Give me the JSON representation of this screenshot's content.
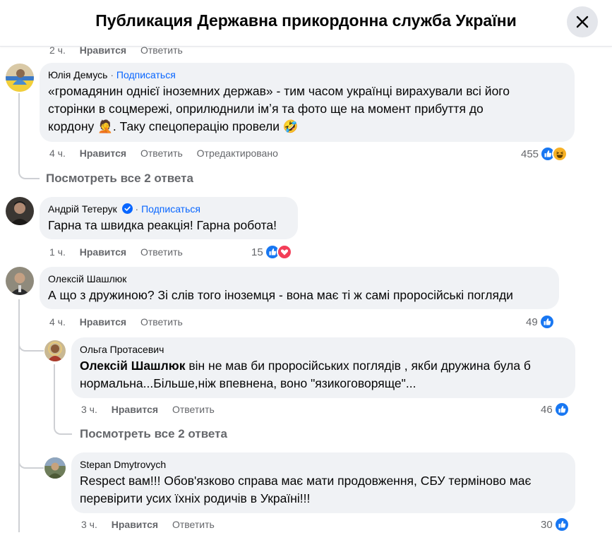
{
  "header": {
    "title": "Публикация Державна прикордонна служба України",
    "close_icon": "close-icon"
  },
  "top_partial": {
    "time": "2 ч.",
    "like": "Нравится",
    "reply": "Ответить"
  },
  "comments": [
    {
      "author": "Юлія Демусь",
      "separator": "·",
      "subscribe": "Подписаться",
      "lines": [
        "«громадянин однієї іноземних держав» - тим часом українці вирахували всі його",
        "сторінки в соцмережі, оприлюднили імʼя та фото ще на момент прибуття до",
        "кордону 🤦. Таку спецоперацію провели 🤣"
      ],
      "time": "4 ч.",
      "like": "Нравится",
      "reply": "Ответить",
      "edited": "Отредактировано",
      "reactions": {
        "count": "455",
        "types": [
          "like",
          "haha"
        ]
      },
      "view_replies": "Посмотреть все 2 ответа"
    },
    {
      "author": "Андрій Тетерук",
      "separator": "·",
      "subscribe": "Подписаться",
      "verified": true,
      "lines": [
        "Гарна та швидка реакція! Гарна робота!"
      ],
      "time": "1 ч.",
      "like": "Нравится",
      "reply": "Ответить",
      "reactions": {
        "count": "15",
        "types": [
          "like",
          "love"
        ]
      }
    },
    {
      "author": "Олексій Шашлюк",
      "lines": [
        "А що з дружиною? Зі слів того іноземця - вона має ті ж самі проросійські погляди"
      ],
      "time": "4 ч.",
      "like": "Нравится",
      "reply": "Ответить",
      "reactions": {
        "count": "49",
        "types": [
          "like"
        ]
      }
    }
  ],
  "replies": [
    {
      "author": "Ольга Протасевич",
      "mention": "Олексій Шашлюк",
      "line1_rest": " він не мав би проросійських поглядів , якби дружина була б",
      "line2": "нормальна...Більше,ніж впевнена, воно \"язикоговоряще\"...",
      "time": "3 ч.",
      "like": "Нравится",
      "reply": "Ответить",
      "reactions": {
        "count": "46",
        "types": [
          "like"
        ]
      },
      "view_replies": "Посмотреть все 2 ответа"
    },
    {
      "author": "Stepan Dmytrovych",
      "lines": [
        "Respect вам!!! Обов'язково справа має мати продовження, СБУ терміново має",
        "перевірити усих їхніх родичів в Україні!!!"
      ],
      "time": "3 ч.",
      "like": "Нравится",
      "reply": "Ответить",
      "reactions": {
        "count": "30",
        "types": [
          "like"
        ]
      }
    }
  ],
  "colors": {
    "link": "#0866ff",
    "bubble": "#f0f2f5",
    "secondary": "#65676b",
    "like": "#1877f2",
    "love": "#f33e58",
    "haha": "#f7b125"
  }
}
